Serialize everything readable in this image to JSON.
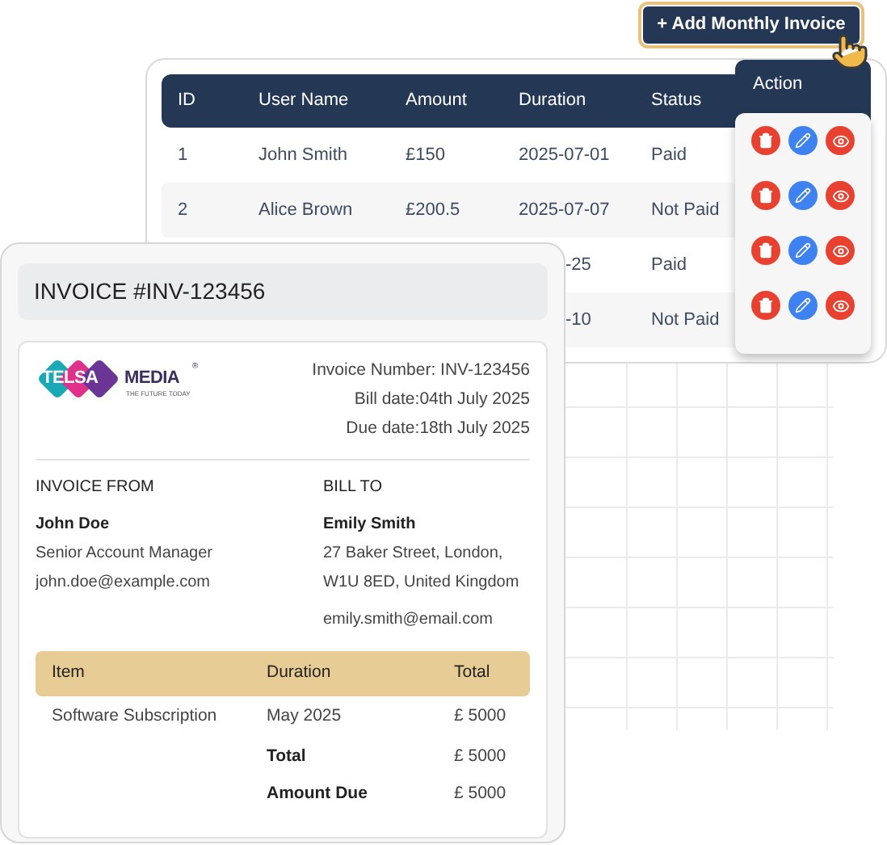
{
  "add_button": {
    "label": "+ Add Monthly Invoice"
  },
  "table": {
    "columns": [
      "ID",
      "User Name",
      "Amount",
      "Duration",
      "Status"
    ],
    "rows": [
      {
        "id": "1",
        "user_name": "John Smith",
        "amount": "£150",
        "duration": "2025-07-01",
        "status": "Paid"
      },
      {
        "id": "2",
        "user_name": "Alice Brown",
        "amount": "£200.5",
        "duration": "2025-07-07",
        "status": "Not Paid"
      },
      {
        "duration": "-25",
        "status": "Paid"
      },
      {
        "duration": "-10",
        "status": "Not Paid"
      }
    ]
  },
  "action_menu": {
    "title": "Action"
  },
  "invoice": {
    "title": "INVOICE #INV-123456",
    "logo": {
      "left": "TELSA",
      "right": "MEDIA",
      "mark": "®",
      "tagline": "THE FUTURE TODAY"
    },
    "meta": [
      "Invoice Number: INV-123456",
      "Bill date:04th July 2025",
      "Due date:18th July 2025"
    ],
    "from": {
      "heading": "INVOICE FROM",
      "name": "John Doe",
      "lines": [
        "Senior Account Manager",
        "john.doe@example.com"
      ]
    },
    "bill_to": {
      "heading": "BILL TO",
      "name": "Emily Smith",
      "lines": [
        "27 Baker Street, London,",
        "W1U 8ED, United Kingdom"
      ],
      "email": "emily.smith@email.com"
    },
    "items": {
      "columns": [
        "Item",
        "Duration",
        "Total"
      ],
      "rows": [
        {
          "item": "Software Subscription",
          "duration": "May 2025",
          "total": "£ 5000"
        }
      ],
      "summary": [
        {
          "label": "Total",
          "value": "£ 5000"
        },
        {
          "label": "Amount Due",
          "value": "£ 5000"
        }
      ]
    }
  }
}
